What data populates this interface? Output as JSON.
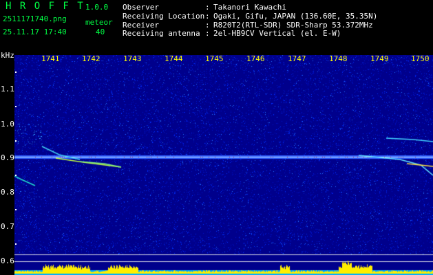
{
  "header": {
    "app_title": "H R O F F T",
    "version": "1.0.0",
    "filename": "2511171740.png",
    "datetime": "25.11.17 17:40",
    "meteor_label": "meteor",
    "meteor_count": "40"
  },
  "station": {
    "rows": [
      {
        "label": "Observer",
        "sep": ":",
        "value": "Takanori Kawachi"
      },
      {
        "label": "Receiving Location",
        "sep": ":",
        "value": "Ogaki, Gifu, JAPAN (136.60E, 35.35N)"
      },
      {
        "label": "Receiver",
        "sep": ":",
        "value": "R820T2(RTL-SDR) SDR-Sharp 53.372MHz"
      },
      {
        "label": "Receiving antenna",
        "sep": ":",
        "value": "2el-HB9CV Vertical (el. E-W)"
      }
    ]
  },
  "axes": {
    "y_unit": "kHz",
    "y_ticks": [
      "1.1",
      "1.0",
      "0.9",
      "0.8",
      "0.7",
      "0.6"
    ],
    "x_ticks": [
      "1741",
      "1742",
      "1743",
      "1744",
      "1745",
      "1746",
      "1747",
      "1748",
      "1749",
      "1750"
    ]
  },
  "colors": {
    "background": "#000000",
    "spectrogram_bg": "#00008c",
    "header_green": "#00ff44",
    "tick_yellow": "#ffff00",
    "carrier": "#d0f0ff"
  }
}
